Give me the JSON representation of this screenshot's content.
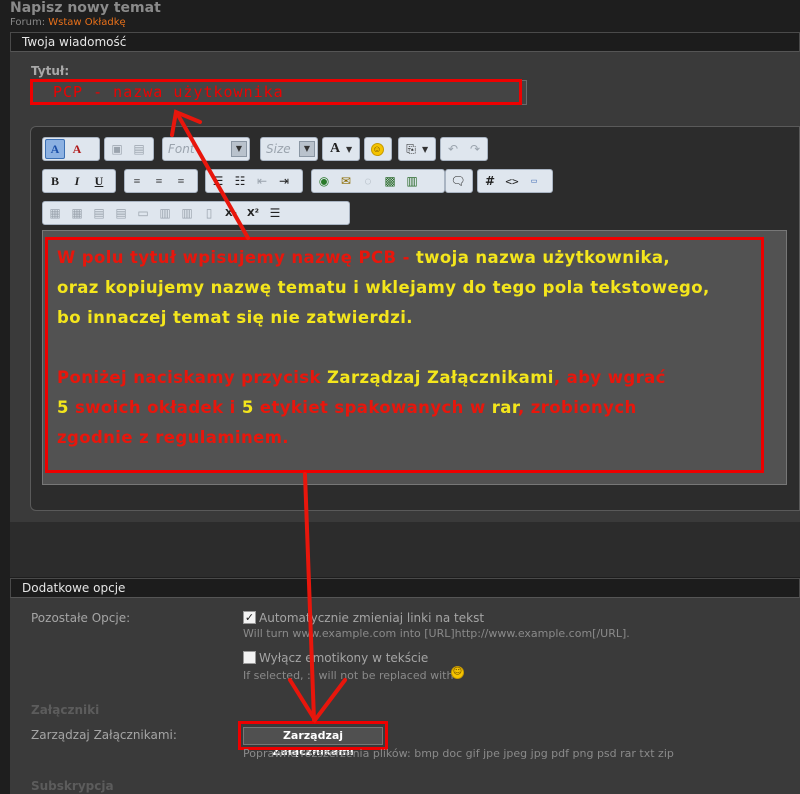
{
  "header": {
    "page_title": "Napisz nowy temat",
    "forum_prefix": "Forum:",
    "forum_link": "Wstaw Okładkę"
  },
  "message_section": {
    "title": "Twoja wiadomość",
    "title_label": "Tytuł:",
    "title_value": "PCP - nazwa użytkownika"
  },
  "toolbar": {
    "font_placeholder": "Font",
    "size_placeholder": "Size",
    "bold": "B",
    "italic": "I",
    "underline": "U",
    "hash": "#",
    "code": "<>",
    "subscript": "X₂",
    "superscript": "X²"
  },
  "editor": {
    "l1_red": "W polu tytuł wpisujemy nazwę  PCB - ",
    "l1_yellow": "twoja nazwa użytkownika,",
    "l2_yellow": "oraz kopiujemy nazwę tematu i wklejamy do tego pola tekstowego,",
    "l3_yellow": "bo innaczej temat się nie zatwierdzi.",
    "l4_red_a": "Poniżej naciskamy przycisk ",
    "l4_yellow": "Zarządzaj Załącznikami",
    "l4_red_b": ", aby wgrać",
    "l5_y1": "5 ",
    "l5_r1": "swoich okładek i ",
    "l5_y2": "5 ",
    "l5_r2": "etykiet spakowanych w ",
    "l5_y3": "rar",
    "l5_r3": ", zrobionych",
    "l6_red": "zgodnie z regulaminem."
  },
  "options_section": {
    "title": "Dodatkowe opcje",
    "other_label": "Pozostałe Opcje:",
    "opt1_label": "Automatycznie zmieniaj linki na tekst",
    "opt1_checked": true,
    "opt1_check_mark": "✓",
    "opt1_help": "Will turn www.example.com into [URL]http://www.example.com[/URL].",
    "opt2_label": "Wyłącz emotikony w tekście",
    "opt2_checked": false,
    "opt2_help": "If selected, :) will not be replaced with",
    "attachments_heading": "Załączniki",
    "attachments_label": "Zarządzaj Załącznikami:",
    "attachments_button": "Zarządzaj Załącznikami",
    "attachments_help": "Poprawne rozszerzenia plików: bmp doc gif jpe jpeg jpg pdf png psd rar txt zip",
    "subscription_heading": "Subskrypcja"
  },
  "colors": {
    "annotation_red": "#e8160c",
    "annotation_yellow": "#f4e61c",
    "forum_link": "#e8701a"
  }
}
